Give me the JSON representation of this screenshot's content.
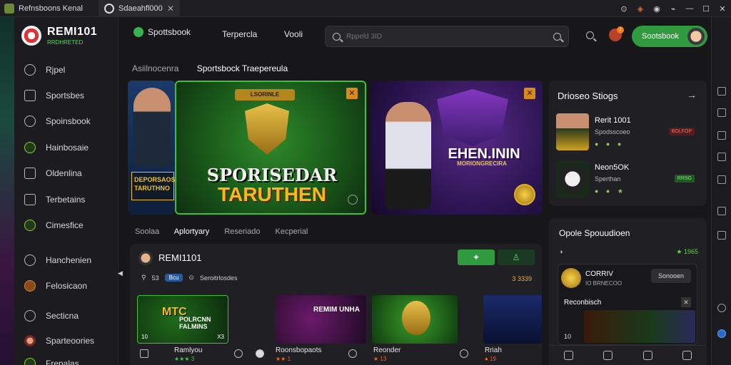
{
  "browser": {
    "tabs": [
      {
        "title": "Refnsboons Kenal"
      },
      {
        "title": "Sdaeahfl000",
        "close": "✕"
      }
    ]
  },
  "brand": {
    "name": "REMI101",
    "tagline": "RRDHRETED"
  },
  "sidebar": {
    "items": [
      {
        "label": "Rjpel",
        "icon": "alarm-icon"
      },
      {
        "label": "Sportsbes",
        "icon": "image-icon"
      },
      {
        "label": "Spoinsbook",
        "icon": "football-icon"
      },
      {
        "label": "Hainbosaie",
        "icon": "dollar-icon"
      },
      {
        "label": "Oldenlina",
        "icon": "window-icon"
      },
      {
        "label": "Terbetains",
        "icon": "chart-icon"
      },
      {
        "label": "Cimesfice",
        "icon": "coin-icon"
      },
      {
        "label": "Hanchenien",
        "icon": "clock-icon"
      },
      {
        "label": "Felosicaon",
        "icon": "badge-icon"
      },
      {
        "label": "Secticna",
        "icon": "target-icon"
      },
      {
        "label": "Sparteoories",
        "icon": "avatar-icon"
      },
      {
        "label": "Frenalas",
        "icon": "trophy-icon"
      }
    ]
  },
  "header": {
    "sportsbook_label": "Spottsbook",
    "links": [
      "Terpercla",
      "Vooli"
    ],
    "search_placeholder": "Rppeld 3ID",
    "notif_count": "1",
    "signup_label": "Sootsbook"
  },
  "breadcrumbs": [
    "Asiilnocenra",
    "Sportsbock Traepereula"
  ],
  "hero": {
    "left_promo": "DEPORSAOS TARUTHNO",
    "main_plate": "LSORINLE",
    "main_title": "SPORISEDAR",
    "main_subtitle": "TARUTHEN",
    "right_title": "EHEN.ININ",
    "right_subtitle": "MORIONGRECIRA"
  },
  "right_panel": {
    "title": "Drioseo Stiogs",
    "arrow": "→",
    "items": [
      {
        "name": "Rerit 1001",
        "sub": "Spodsscoeo",
        "icons": "● ● ●",
        "tag": "BOLFOP"
      },
      {
        "name": "Neon5OK",
        "sub": "Sperthan",
        "icons": "● ● ★",
        "tag": "RRSG"
      }
    ]
  },
  "right_panel2": {
    "title": "Opole Spouudioen",
    "meta_left": "◑",
    "meta_right": "★ 1965",
    "card": {
      "name": "CORRIV",
      "sub": "IO BRNECOO",
      "button": "Sonooen",
      "label": "Reconbisch",
      "close": "✕",
      "num": "10"
    }
  },
  "games": {
    "tabs": [
      "Soolaa",
      "Aplortyary",
      "Reseriado",
      "Kecperial"
    ],
    "user": "REMI1101",
    "meta_count": "53",
    "chip": "Bcu",
    "meta_text": "Seroitrlosdes",
    "score": "3 3339",
    "cards": [
      {
        "title": "MTC",
        "title2": "POLRCNN FALMINS",
        "num": "10",
        "tag": "X3",
        "name": "Ramlyou",
        "stars": "★★★ 3"
      },
      {
        "title": "REMIM UNHA",
        "num": "",
        "tag": "",
        "name": "Roonsbopaots",
        "stars": "★★ 1"
      },
      {
        "title": "",
        "num": "",
        "tag": "",
        "name": "Reonder",
        "stars": "★ 13"
      },
      {
        "title": "",
        "num": "",
        "tag": "",
        "name": "Rriah",
        "stars": "● 19"
      }
    ]
  }
}
